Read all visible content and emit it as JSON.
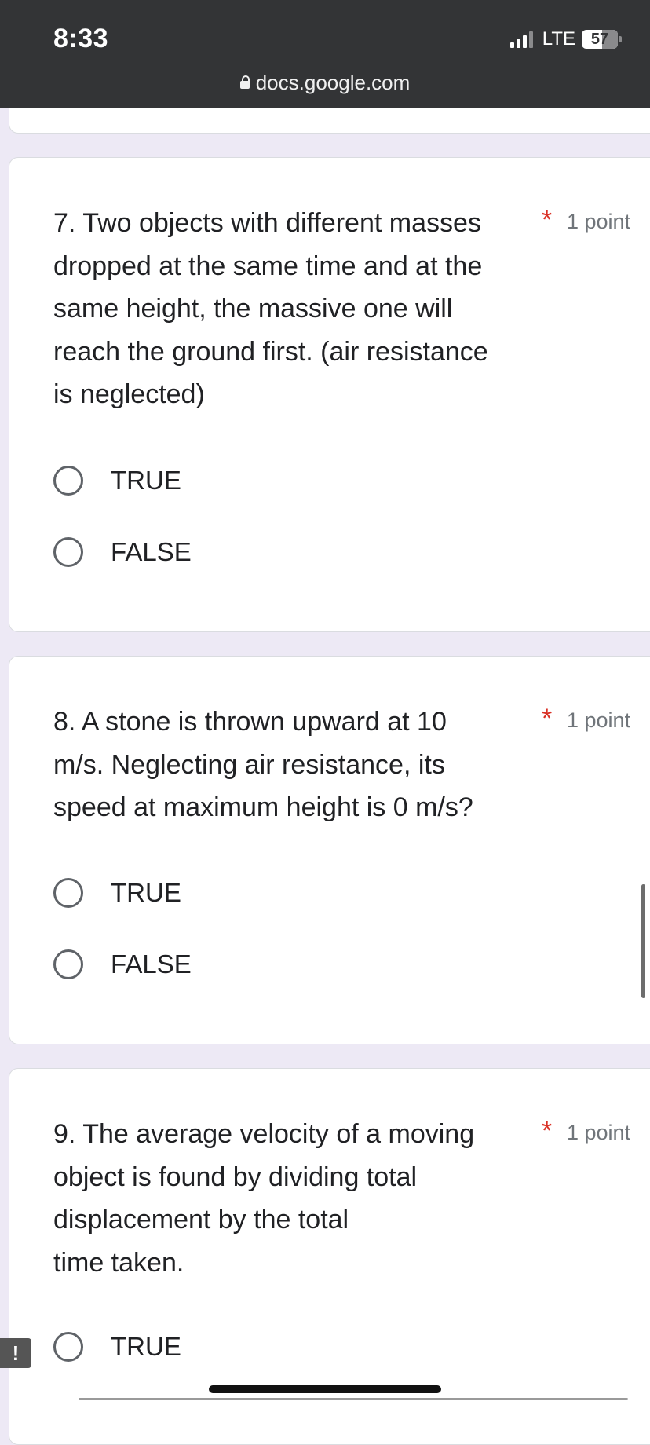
{
  "status_bar": {
    "time": "8:33",
    "network": "LTE",
    "battery": "57"
  },
  "url_bar": {
    "domain": "docs.google.com"
  },
  "questions": [
    {
      "title": "7.  Two objects with different masses\ndropped at the same time and at the\nsame height, the massive one will\nreach the ground first. (air resistance\nis neglected)",
      "required": "*",
      "points": "1 point",
      "options": [
        "TRUE",
        "FALSE"
      ]
    },
    {
      "title": "8.  A stone is thrown upward at 10\nm/s. Neglecting air resistance, its\nspeed at maximum height is 0 m/s?",
      "required": "*",
      "points": "1 point",
      "options": [
        "TRUE",
        "FALSE"
      ]
    },
    {
      "title": "9. The average velocity of a moving\nobject is found by dividing total\ndisplacement by the total\ntime taken.",
      "required": "*",
      "points": "1 point",
      "options": [
        "TRUE"
      ]
    }
  ],
  "feedback": {
    "icon_label": "!"
  },
  "colors": {
    "required_star": "#d93025",
    "page_background": "#ede9f5",
    "status_bar": "#333436"
  }
}
